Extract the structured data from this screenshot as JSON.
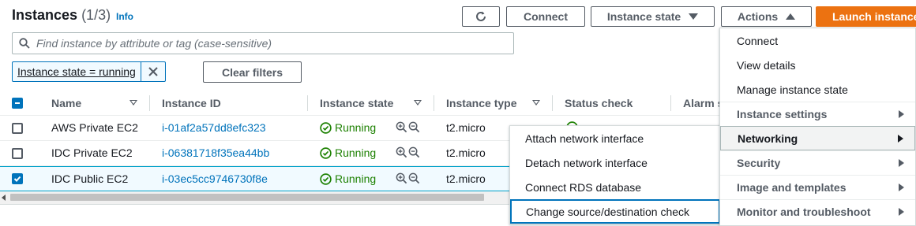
{
  "header": {
    "title": "Instances",
    "count": "(1/3)",
    "info": "Info"
  },
  "toolbar": {
    "connect": "Connect",
    "instance_state": "Instance state",
    "actions": "Actions",
    "launch": "Launch instances"
  },
  "search": {
    "placeholder": "Find instance by attribute or tag (case-sensitive)"
  },
  "filters": {
    "token": "Instance state = running",
    "clear": "Clear filters"
  },
  "table": {
    "columns": [
      "Name",
      "Instance ID",
      "Instance state",
      "Instance type",
      "Status check",
      "Alarm s"
    ],
    "rows": [
      {
        "name": "AWS Private EC2",
        "id": "i-01af2a57dd8efc323",
        "state": "Running",
        "type": "t2.micro",
        "selected": false
      },
      {
        "name": "IDC Private EC2",
        "id": "i-06381718f35ea44bb",
        "state": "Running",
        "type": "t2.micro",
        "selected": false
      },
      {
        "name": "IDC Public EC2",
        "id": "i-03ec5cc9746730f8e",
        "state": "Running",
        "type": "t2.micro",
        "selected": true
      }
    ]
  },
  "actions_menu": {
    "items": [
      {
        "label": "Connect",
        "group": false
      },
      {
        "label": "View details",
        "group": false
      },
      {
        "label": "Manage instance state",
        "group": false
      },
      {
        "label": "Instance settings",
        "group": true
      },
      {
        "label": "Networking",
        "group": true
      },
      {
        "label": "Security",
        "group": true
      },
      {
        "label": "Image and templates",
        "group": true
      },
      {
        "label": "Monitor and troubleshoot",
        "group": true
      }
    ]
  },
  "networking_submenu": {
    "items": [
      "Attach network interface",
      "Detach network interface",
      "Connect RDS database",
      "Change source/destination check"
    ]
  },
  "colors": {
    "accent": "#0073bb",
    "launch": "#ec7211",
    "running": "#1d8102"
  }
}
